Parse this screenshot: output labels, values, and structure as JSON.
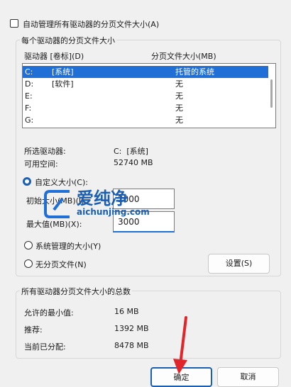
{
  "top": {
    "auto_manage_label": "自动管理所有驱动器的分页文件大小(A)"
  },
  "group1": {
    "title": "每个驱动器的分页文件大小",
    "col_drive": "驱动器 [卷标](D)",
    "col_pagefile": "分页文件大小(MB)",
    "rows": [
      {
        "drive": "C:",
        "label": "[系统]",
        "size": "托管的系统",
        "selected": true
      },
      {
        "drive": "D:",
        "label": "[软件]",
        "size": "无",
        "selected": false
      },
      {
        "drive": "E:",
        "label": "",
        "size": "无",
        "selected": false
      },
      {
        "drive": "F:",
        "label": "",
        "size": "无",
        "selected": false
      },
      {
        "drive": "G:",
        "label": "",
        "size": "无",
        "selected": false
      }
    ],
    "selected_drive_label": "所选驱动器:",
    "selected_drive_value": "C:  [系统]",
    "available_space_label": "可用空间:",
    "available_space_value": "52740 MB",
    "custom_size_label": "自定义大小(C):",
    "initial_size_label": "初始大小(MB)(I):",
    "initial_size_value": "2000",
    "max_size_label": "最大值(MB)(X):",
    "max_size_value": "3000",
    "system_managed_label": "系统管理的大小(Y)",
    "no_paging_label": "无分页文件(N)",
    "set_button": "设置(S)"
  },
  "group2": {
    "title": "所有驱动器分页文件大小的总数",
    "min_allowed_label": "允许的最小值:",
    "min_allowed_value": "16 MB",
    "recommended_label": "推荐:",
    "recommended_value": "1392 MB",
    "current_label": "当前已分配:",
    "current_value": "8478 MB"
  },
  "footer": {
    "ok_button": "确定",
    "cancel_button": "取消"
  },
  "watermark": {
    "text": "爱纯净",
    "url": "aichunjing.com"
  },
  "colors": {
    "accent": "#1f6fd6",
    "arrow": "#e0262b"
  }
}
